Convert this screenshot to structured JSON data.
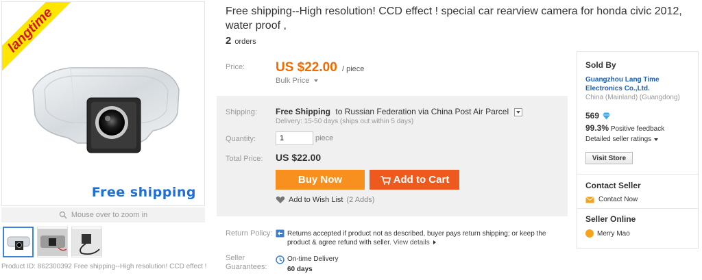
{
  "gallery": {
    "ribbon_text": "langtime",
    "overlay_text": "Free  shipping",
    "zoom_hint": "Mouse over to zoom in",
    "product_id_line": "Product ID: 862300392 Free shipping--High resolution! CCD effect !"
  },
  "product": {
    "title": "Free shipping--High resolution! CCD effect ! special car rearview camera for honda civic 2012, water proof ,",
    "orders_count": "2",
    "orders_label": "orders"
  },
  "price": {
    "label": "Price:",
    "value": "US $22.00",
    "unit": "/ piece",
    "bulk": "Bulk Price"
  },
  "shipping": {
    "label": "Shipping:",
    "method_bold": "Free Shipping",
    "destination": "to Russian Federation via China Post Air Parcel",
    "delivery": "Delivery: 15-50 days (ships out within 5 days)"
  },
  "quantity": {
    "label": "Quantity:",
    "value": "1",
    "unit": "piece"
  },
  "total": {
    "label": "Total Price:",
    "value": "US $22.00"
  },
  "actions": {
    "buy_now": "Buy Now",
    "add_to_cart": "Add to Cart",
    "wishlist": "Add to Wish List",
    "wishlist_count": "(2 Adds)"
  },
  "policy": {
    "return_label": "Return Policy:",
    "return_text": "Returns accepted if product not as described, buyer pays return shipping; or keep the product & agree refund with seller.",
    "view_details": "View details",
    "guarantee_label_1": "Seller",
    "guarantee_label_2": "Guarantees:",
    "ontime": "On-time Delivery",
    "ontime_days": "60 days"
  },
  "seller": {
    "sold_by": "Sold By",
    "company": "Guangzhou Lang Time Electronics Co.,Ltd.",
    "location": "China (Mainland) (Guangdong)",
    "score": "569",
    "positive_pct": "99.3%",
    "positive_label": "Positive feedback",
    "detailed_ratings": "Detailed seller ratings",
    "visit_store": "Visit Store",
    "contact_title": "Contact Seller",
    "contact_now": "Contact Now",
    "online_title": "Seller Online",
    "online_user": "Merry Mao"
  },
  "colors": {
    "price_orange": "#f06c00",
    "buy_now_bg": "#f7901e",
    "cart_bg": "#ee5a1e",
    "link_blue": "#1c5fb2"
  }
}
